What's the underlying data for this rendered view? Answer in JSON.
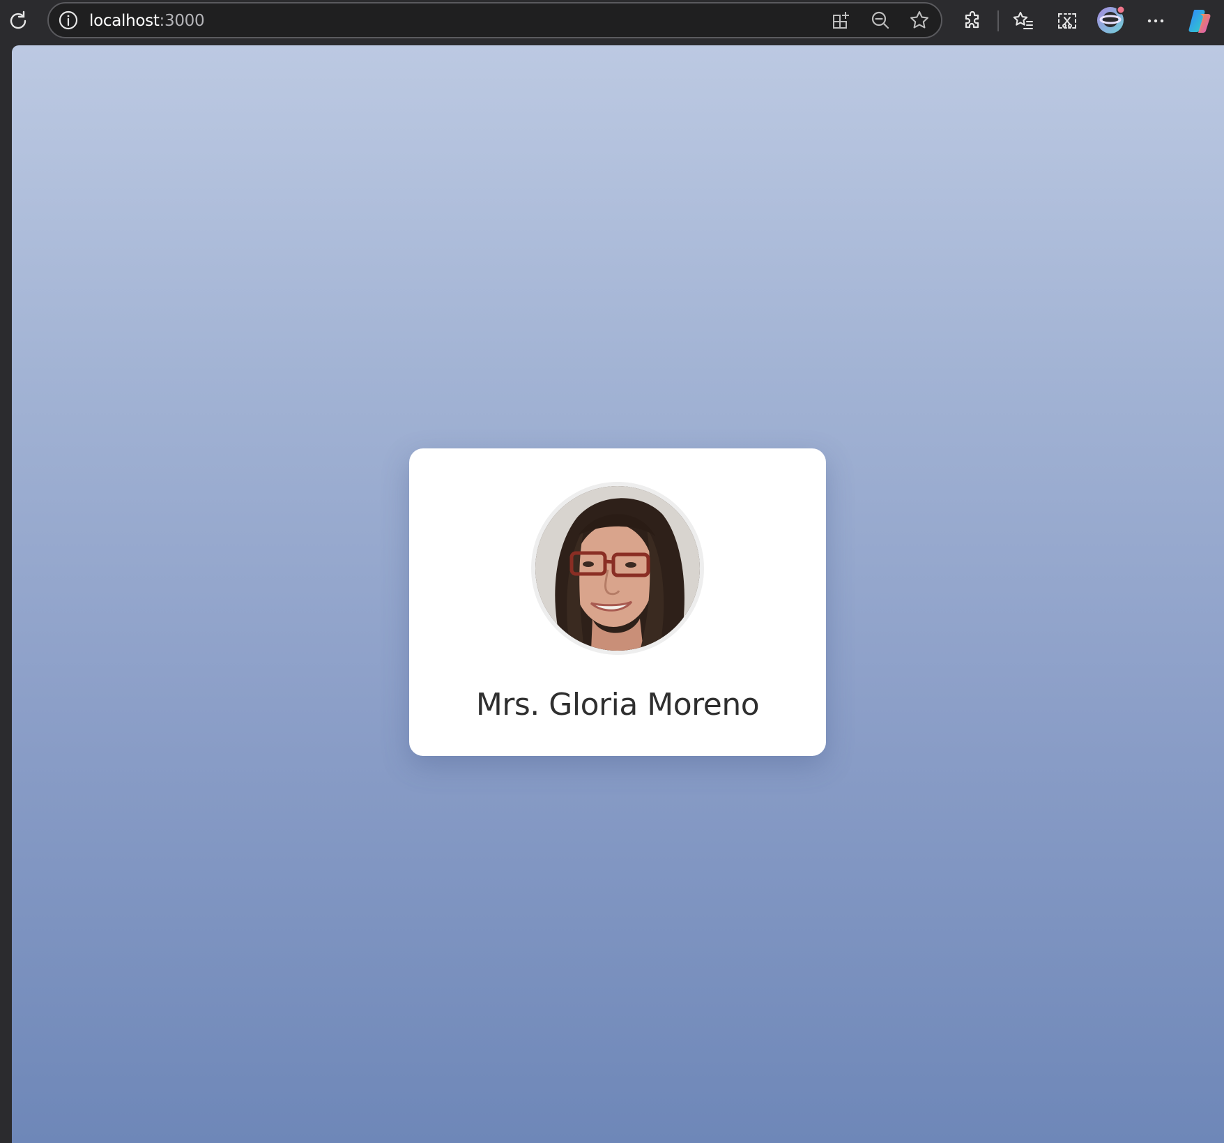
{
  "browser": {
    "url_host": "localhost",
    "url_port": ":3000",
    "icons": [
      "reload-icon",
      "site-info-icon",
      "app-available-icon",
      "zoom-out-icon",
      "favorite-star-icon",
      "extensions-icon",
      "favorites-list-icon",
      "screenshot-icon",
      "profile-avatar-icon",
      "more-options-icon",
      "copilot-icon"
    ]
  },
  "profile": {
    "name": "Mrs. Gloria Moreno"
  },
  "colors": {
    "gradient_top": "#bcc9e2",
    "gradient_bottom": "#6e87b8",
    "card_background": "#ffffff",
    "name_text": "#2f2f2f",
    "chrome_background": "#2b2b2e"
  }
}
